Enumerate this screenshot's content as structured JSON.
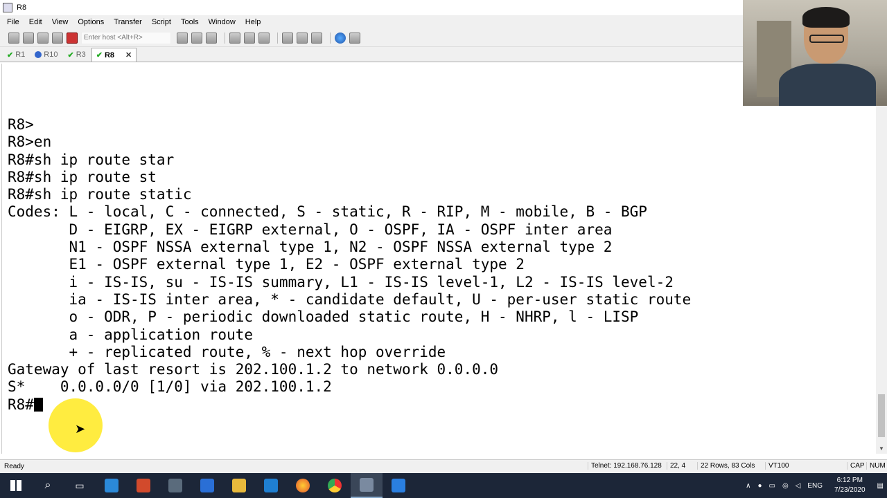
{
  "window": {
    "title": "R8"
  },
  "menu": [
    "File",
    "Edit",
    "View",
    "Options",
    "Transfer",
    "Script",
    "Tools",
    "Window",
    "Help"
  ],
  "toolbar": {
    "host_placeholder": "Enter host <Alt+R>"
  },
  "tabs": [
    {
      "label": "R1",
      "status": "connected"
    },
    {
      "label": "R10",
      "status": "info"
    },
    {
      "label": "R3",
      "status": "connected"
    },
    {
      "label": "R8",
      "status": "connected",
      "active": true
    }
  ],
  "terminal": {
    "lines": [
      "R8>",
      "R8>en",
      "R8#sh ip route star",
      "R8#sh ip route st",
      "R8#sh ip route static",
      "Codes: L - local, C - connected, S - static, R - RIP, M - mobile, B - BGP",
      "       D - EIGRP, EX - EIGRP external, O - OSPF, IA - OSPF inter area",
      "       N1 - OSPF NSSA external type 1, N2 - OSPF NSSA external type 2",
      "       E1 - OSPF external type 1, E2 - OSPF external type 2",
      "       i - IS-IS, su - IS-IS summary, L1 - IS-IS level-1, L2 - IS-IS level-2",
      "       ia - IS-IS inter area, * - candidate default, U - per-user static route",
      "       o - ODR, P - periodic downloaded static route, H - NHRP, l - LISP",
      "       a - application route",
      "       + - replicated route, % - next hop override",
      "",
      "Gateway of last resort is 202.100.1.2 to network 0.0.0.0",
      "",
      "S*    0.0.0.0/0 [1/0] via 202.100.1.2"
    ],
    "prompt": "R8#"
  },
  "status": {
    "ready": "Ready",
    "connection": "Telnet: 192.168.76.128",
    "position": "22,  4",
    "size": "22 Rows, 83 Cols",
    "emulation": "VT100",
    "caps": "CAP",
    "num": "NUM"
  },
  "taskbar": {
    "language": "ENG",
    "time": "6:12 PM",
    "date": "7/23/2020"
  }
}
